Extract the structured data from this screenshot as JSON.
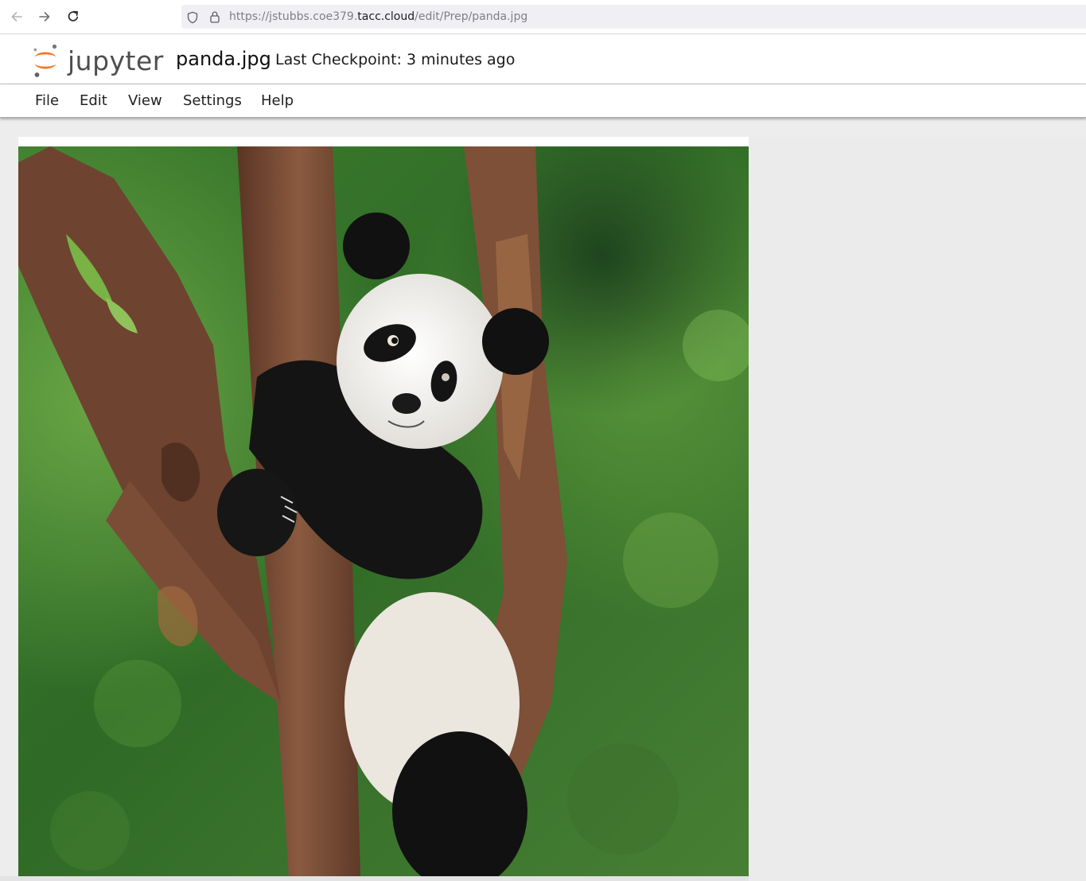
{
  "browser": {
    "url_prefix": "https://jstubbs.coe379.",
    "url_domain": "tacc.cloud",
    "url_path": "/edit/Prep/panda.jpg",
    "back_icon": "arrow-left-icon",
    "forward_icon": "arrow-right-icon",
    "reload_icon": "reload-icon",
    "shield_icon": "shield-icon",
    "lock_icon": "lock-icon"
  },
  "header": {
    "logo_text": "jupyter",
    "logo_accent": "#f37726",
    "doc_title": "panda.jpg",
    "checkpoint": "Last Checkpoint: 3 minutes ago"
  },
  "menu": {
    "items": [
      "File",
      "Edit",
      "View",
      "Settings",
      "Help"
    ]
  },
  "viewer": {
    "image_subject": "panda-image"
  }
}
